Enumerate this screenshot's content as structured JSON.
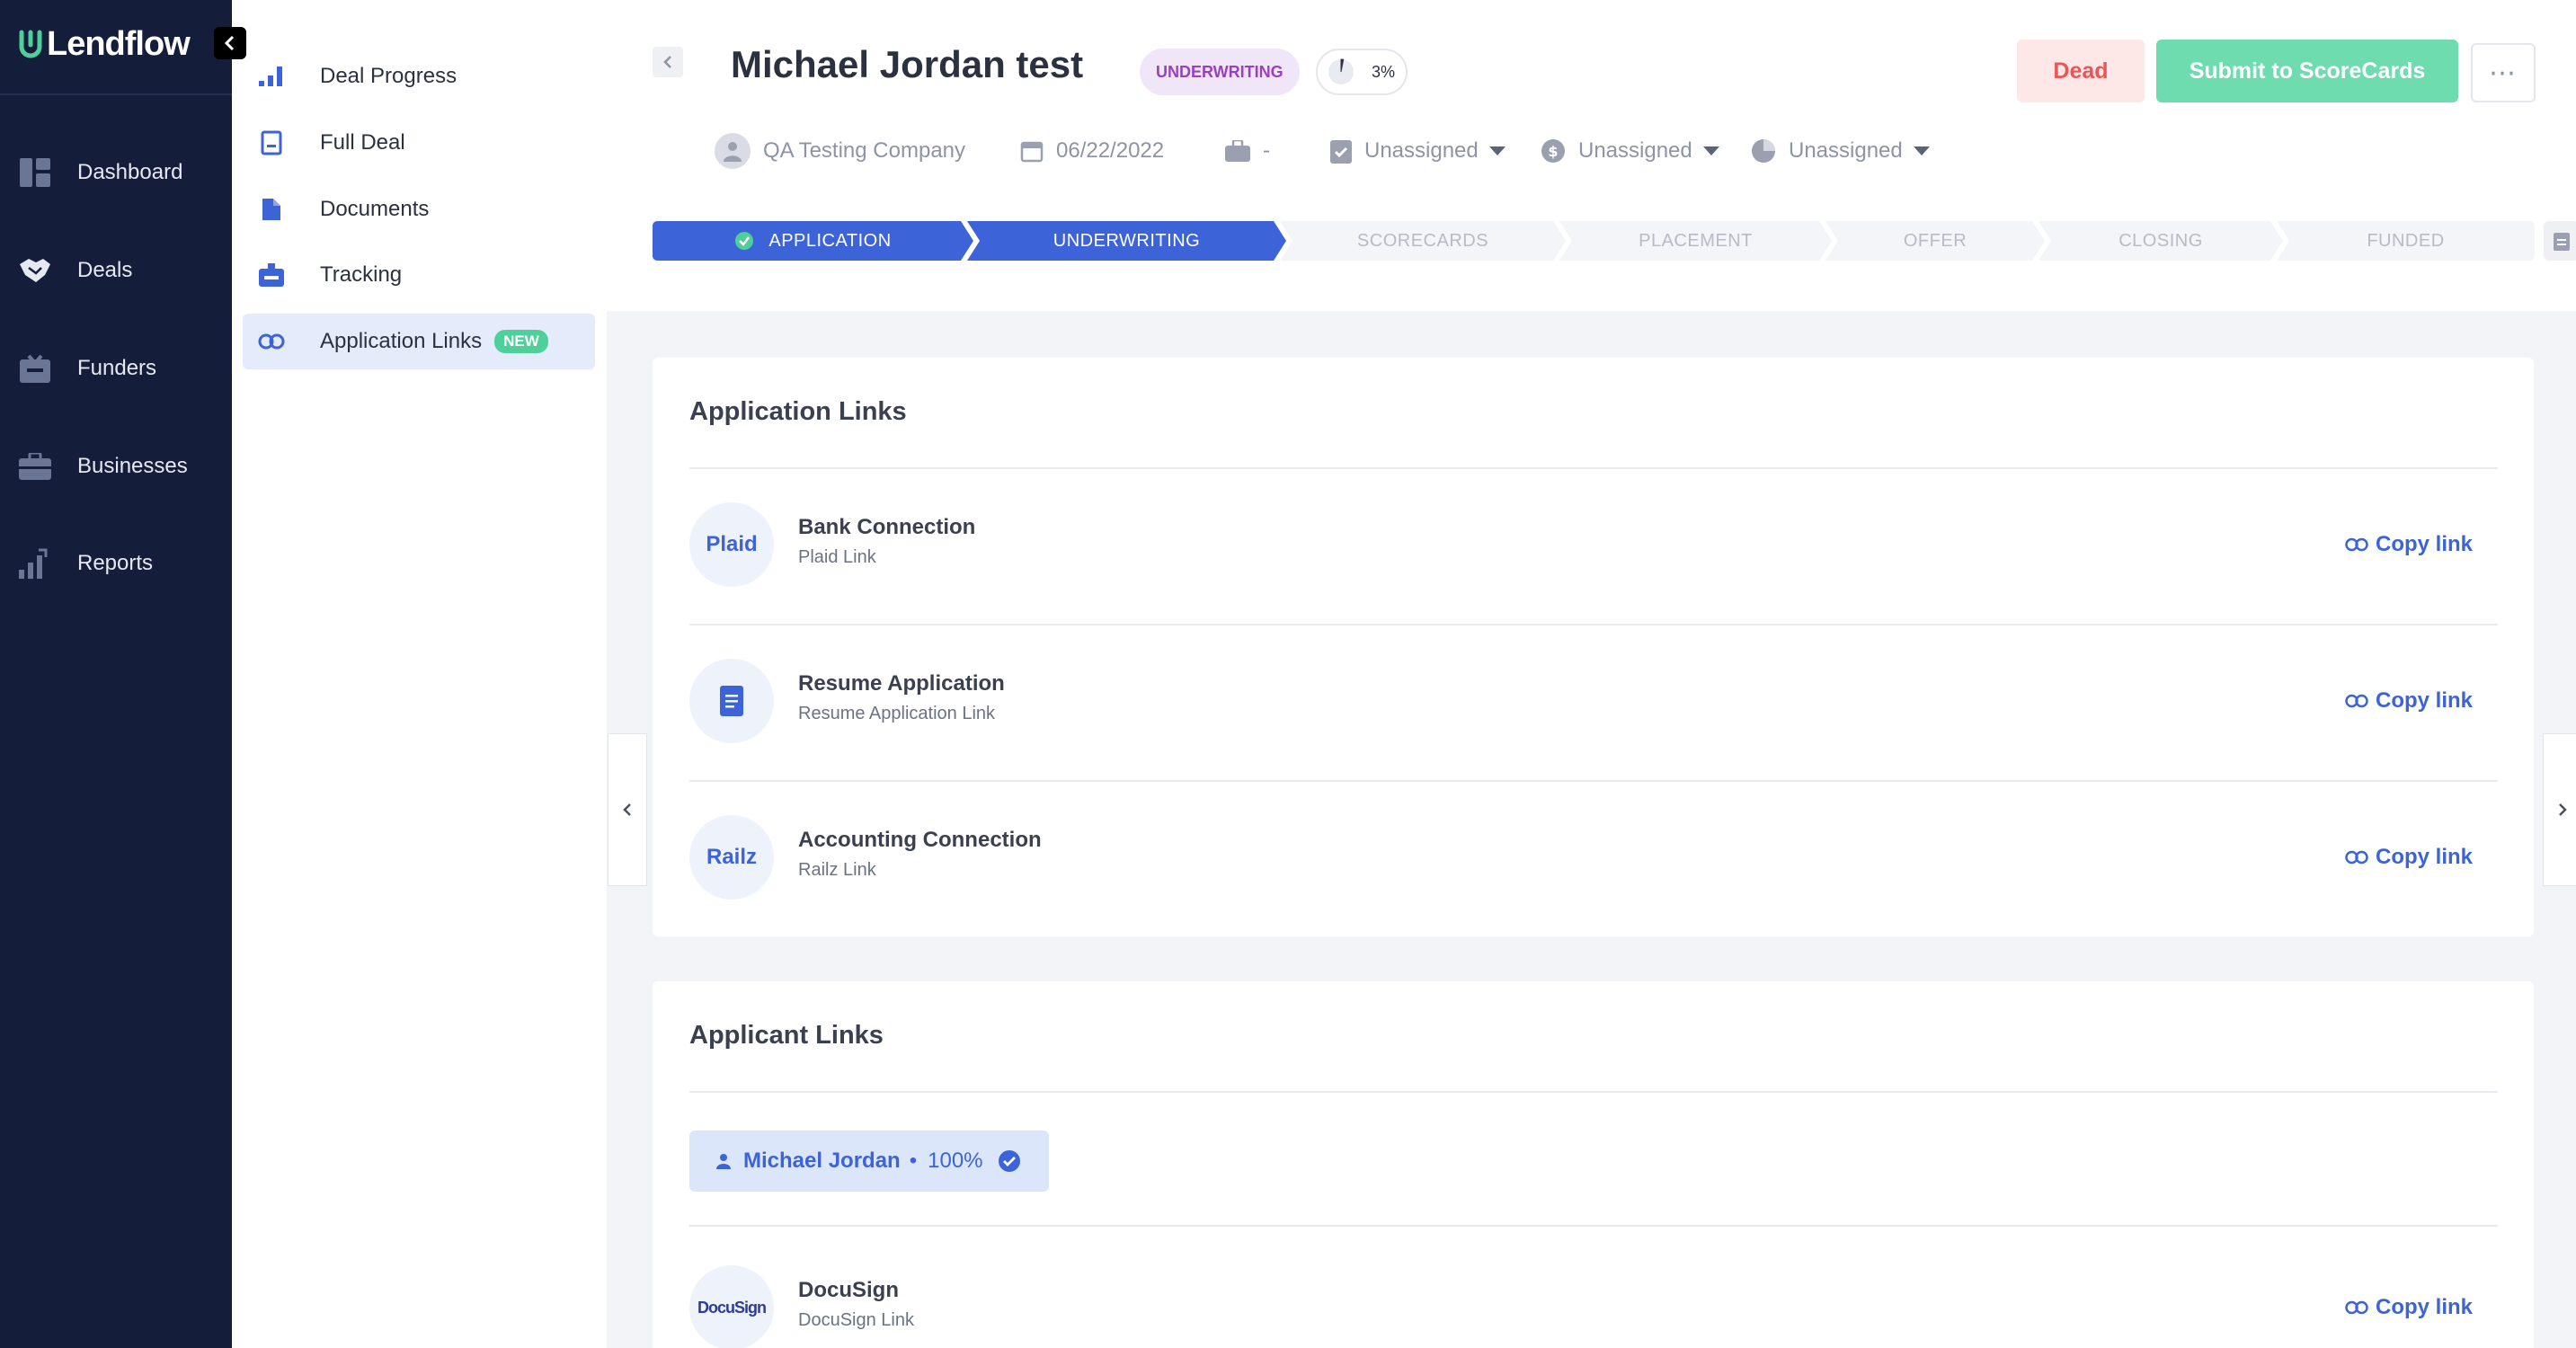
{
  "brand": {
    "name": "Lendflow"
  },
  "leftnav": {
    "items": [
      {
        "label": "Dashboard",
        "icon": "dashboard-icon"
      },
      {
        "label": "Deals",
        "icon": "handshake-icon"
      },
      {
        "label": "Funders",
        "icon": "inbox-icon"
      },
      {
        "label": "Businesses",
        "icon": "briefcase-icon"
      },
      {
        "label": "Reports",
        "icon": "bar-chart-icon"
      }
    ]
  },
  "subnav": {
    "items": [
      {
        "label": "Deal Progress",
        "icon": "progress-bars-icon"
      },
      {
        "label": "Full Deal",
        "icon": "document-outline-icon"
      },
      {
        "label": "Documents",
        "icon": "file-icon"
      },
      {
        "label": "Tracking",
        "icon": "tray-icon"
      },
      {
        "label": "Application Links",
        "icon": "link-icon",
        "badge": "NEW",
        "active": true
      }
    ]
  },
  "header": {
    "title": "Michael Jordan test",
    "stage_badge": "UNDERWRITING",
    "progress": "3%",
    "progress_value": 0.03,
    "dead_label": "Dead",
    "submit_label": "Submit to ScoreCards",
    "more_label": "⋯",
    "company": "QA Testing Company",
    "date": "06/22/2022",
    "briefcase_value": "-",
    "assignees": [
      "Unassigned",
      "Unassigned",
      "Unassigned"
    ]
  },
  "stages": [
    {
      "label": "APPLICATION",
      "state": "completed"
    },
    {
      "label": "UNDERWRITING",
      "state": "current"
    },
    {
      "label": "SCORECARDS",
      "state": "pending"
    },
    {
      "label": "PLACEMENT",
      "state": "pending"
    },
    {
      "label": "OFFER",
      "state": "pending"
    },
    {
      "label": "CLOSING",
      "state": "pending"
    },
    {
      "label": "FUNDED",
      "state": "pending"
    }
  ],
  "application_links": {
    "title": "Application Links",
    "items": [
      {
        "logo_text": "Plaid",
        "name": "Bank Connection",
        "sub": "Plaid Link",
        "action": "Copy link"
      },
      {
        "logo_text": "",
        "name": "Resume Application",
        "sub": "Resume Application Link",
        "action": "Copy link"
      },
      {
        "logo_text": "Railz",
        "name": "Accounting Connection",
        "sub": "Railz Link",
        "action": "Copy link"
      }
    ]
  },
  "applicant_links": {
    "title": "Applicant Links",
    "applicant_name": "Michael Jordan",
    "applicant_dot": "•",
    "applicant_progress": "100%",
    "items": [
      {
        "logo_text": "DocuSign",
        "name": "DocuSign",
        "sub": "DocuSign Link",
        "action": "Copy link"
      }
    ]
  },
  "colors": {
    "nav_bg": "#141d3a",
    "accent": "#3d63d9",
    "stage_done": "#3d63d9",
    "success": "#6fdcb0",
    "danger": "#e85656",
    "badge_purple": "#9c3fbf"
  }
}
